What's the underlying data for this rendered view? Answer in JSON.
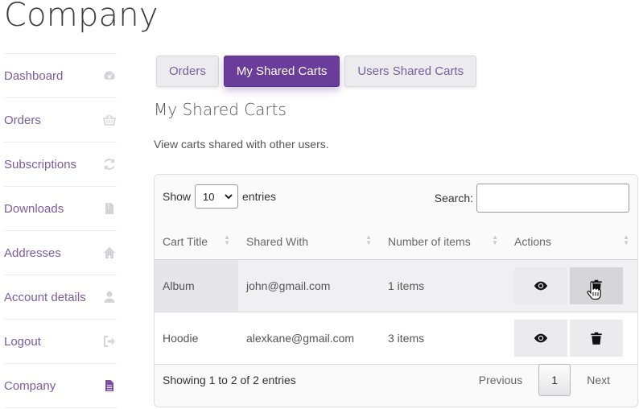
{
  "page": {
    "title": "Company"
  },
  "sidebar": {
    "items": [
      {
        "label": "Dashboard",
        "icon": "dashboard-icon"
      },
      {
        "label": "Orders",
        "icon": "basket-icon"
      },
      {
        "label": "Subscriptions",
        "icon": "refresh-icon"
      },
      {
        "label": "Downloads",
        "icon": "file-icon"
      },
      {
        "label": "Addresses",
        "icon": "home-icon"
      },
      {
        "label": "Account details",
        "icon": "user-icon"
      },
      {
        "label": "Logout",
        "icon": "sign-out-icon"
      },
      {
        "label": "Company",
        "icon": "document-icon",
        "active": true
      }
    ]
  },
  "tabs": [
    {
      "label": "Orders"
    },
    {
      "label": "My Shared Carts",
      "active": true
    },
    {
      "label": "Users Shared Carts"
    }
  ],
  "section": {
    "title": "My Shared Carts",
    "description": "View carts shared with other users."
  },
  "table_controls": {
    "show_label": "Show",
    "entries_value": "10",
    "entries_label": "entries",
    "search_label": "Search:",
    "search_value": ""
  },
  "table": {
    "columns": [
      "Cart Title",
      "Shared With",
      "Number of items",
      "Actions"
    ],
    "rows": [
      {
        "title": "Album",
        "shared_with": "john@gmail.com",
        "items": "1 items"
      },
      {
        "title": "Hoodie",
        "shared_with": "alexkane@gmail.com",
        "items": "3 items"
      }
    ]
  },
  "footer": {
    "info": "Showing 1 to 2 of 2 entries",
    "previous": "Previous",
    "current_page": "1",
    "next": "Next"
  },
  "colors": {
    "accent": "#6b3d9a",
    "link": "#7a5c9f"
  }
}
